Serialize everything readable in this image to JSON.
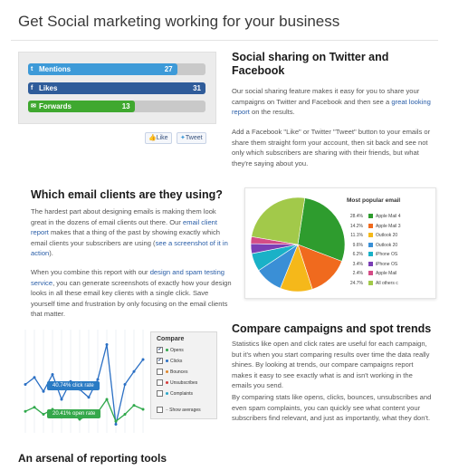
{
  "page_title": "Get Social marketing working for your business",
  "social": {
    "bars": [
      {
        "label": "Mentions",
        "count": "27",
        "color": "#3d9ad8",
        "level": 0.84
      },
      {
        "label": "Likes",
        "count": "31",
        "color": "#2f5c9a",
        "level": 1.0
      },
      {
        "label": "Forwards",
        "count": "13",
        "color": "#3fa82f",
        "level": 0.6
      }
    ],
    "like_button": "Like",
    "tweet_button": "Tweet",
    "heading": "Social sharing on Twitter and Facebook",
    "para1_pre": "Our social sharing feature makes it easy for you to share your campaigns on Twitter and Facebook and then see a",
    "para1_link": "great looking report",
    "para1_post": "on the results.",
    "para2": "Add a Facebook \"Like\" or Twitter \"Tweet\" button to your emails or share them straight form your account, then sit back and see not only which subscribers are sharing with their friends, but what they're saying about you."
  },
  "clients": {
    "heading": "Which email clients are they using?",
    "para1_pre": "The hardest part about designing emails is making them look great in the dozens of email clients out there. Our",
    "para1_link1": "email client report",
    "para1_mid": "makes that a thing of the past by showing exactly which email clients your subscribers are using (",
    "para1_link2": "see a screenshot of it in action",
    "para1_post": ").",
    "para2_pre": "When you combine this report with our",
    "para2_link": "design and spam testing service",
    "para2_post": ", you can generate screenshots of exactly how your design looks in all these email key clients with a single click. Save yourself time and frustration by only focusing on the email clients that matter."
  },
  "chart_data": {
    "type": "pie",
    "title": "Most popular email",
    "categories": [
      "Apple Mail 4",
      "Apple Mail 3",
      "Outlook 20",
      "Outlook 20",
      "iPhone OS",
      "iPhone OS",
      "Apple Mail",
      "All others c"
    ],
    "values": [
      28.4,
      14.2,
      11.1,
      9.6,
      6.2,
      3.4,
      2.4,
      24.7
    ],
    "value_labels": [
      "28.4%",
      "14.2%",
      "11.1%",
      "9.6%",
      "6.2%",
      "3.4%",
      "2.4%",
      "24.7%"
    ],
    "colors": [
      "#2e9c2e",
      "#f06a1e",
      "#f5b81a",
      "#3a8fd6",
      "#1ab1c7",
      "#7b3fb5",
      "#d44c86",
      "#a2c94a"
    ]
  },
  "compare": {
    "heading": "Compare campaigns and spot trends",
    "para1": "Statistics like open and click rates are useful for each campaign, but it's when you start comparing results over time the data really shines. By looking at trends, our compare campaigns report makes it easy to see exactly what is and isn't working in the emails you send.",
    "para2": "By comparing stats like opens, clicks, bounces, unsubscribes and even spam complaints, you can quickly see what content your subscribers find relevant, and just as importantly, what they don't.",
    "widget_title": "Compare",
    "options": [
      {
        "label": "Opens",
        "checked": true,
        "color": "#2ea84a"
      },
      {
        "label": "Clicks",
        "checked": true,
        "color": "#2a6fc4"
      },
      {
        "label": "Bounces",
        "checked": false,
        "color": "#e0862a"
      },
      {
        "label": "Unsubscribes",
        "checked": false,
        "color": "#d63b3b"
      },
      {
        "label": "Complaints",
        "checked": false,
        "color": "#2aa6c9"
      }
    ],
    "averages_label": "Show averages",
    "click_tag": "40.74% click rate",
    "open_tag": "20.41% open rate"
  },
  "bottom_heading": "An arsenal of reporting tools"
}
